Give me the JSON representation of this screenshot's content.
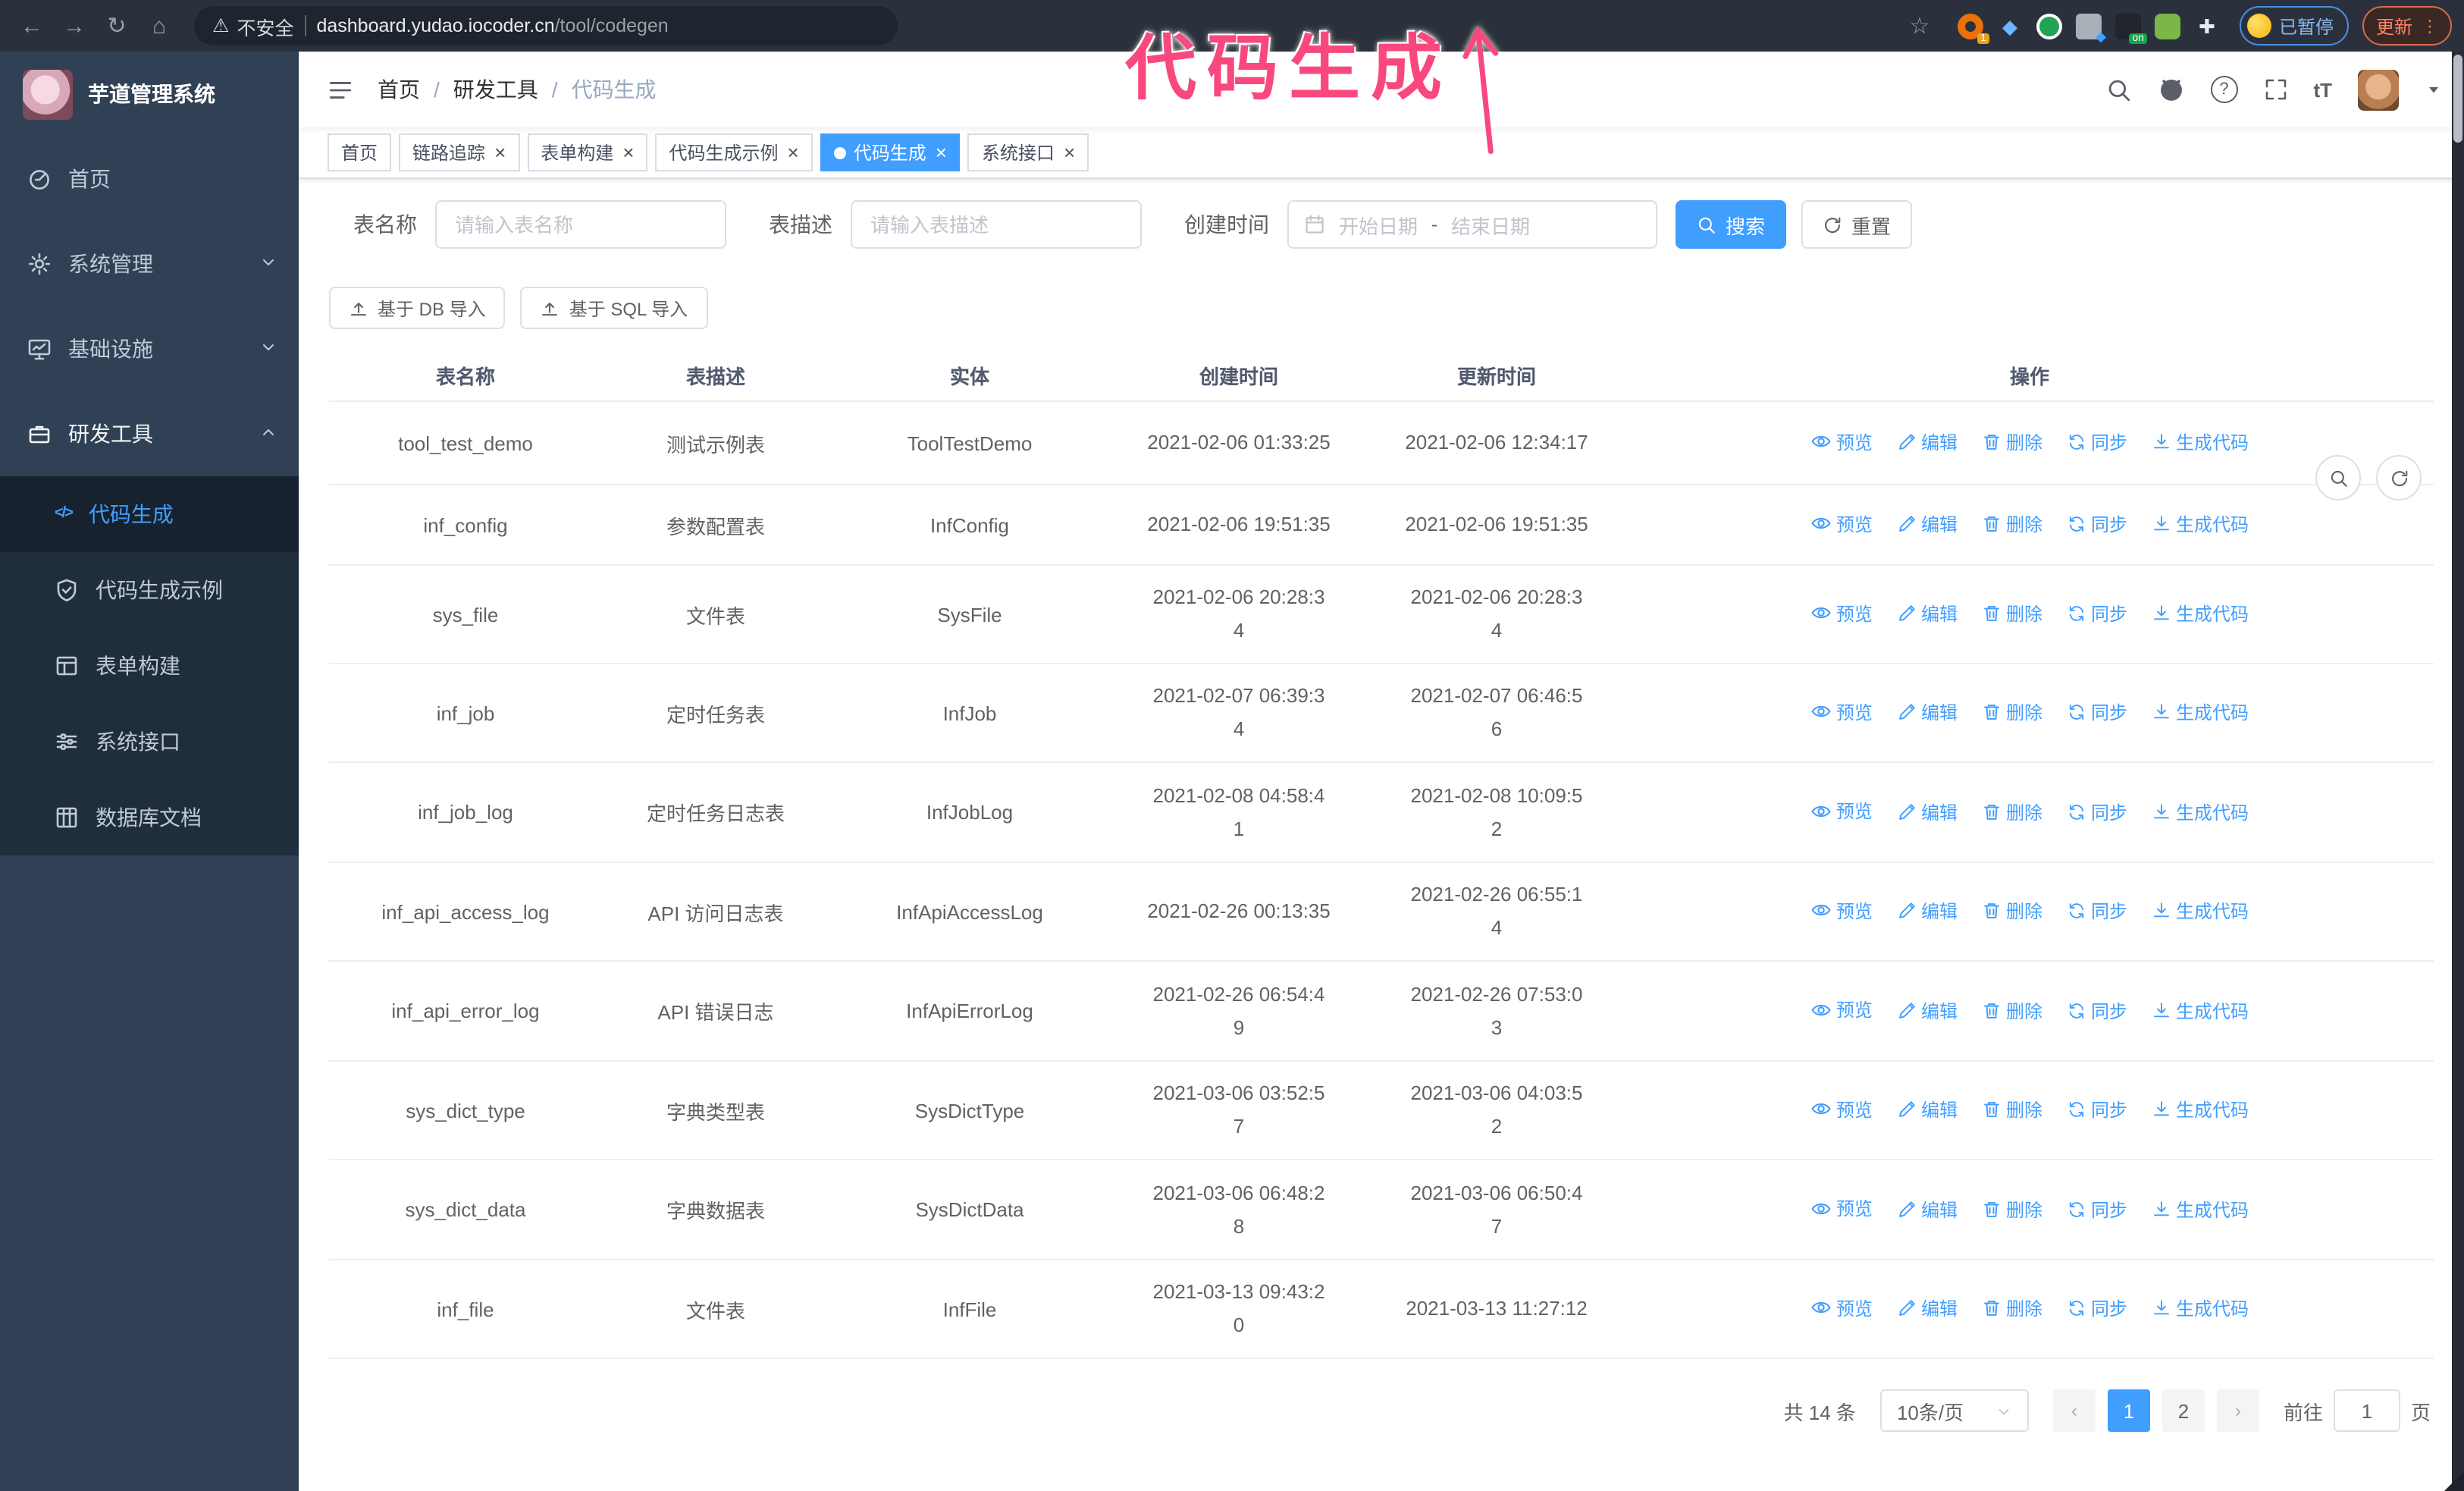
{
  "browser": {
    "security_label": "不安全",
    "url_host": "dashboard.yudao.iocoder.cn",
    "url_path": "/tool/codegen",
    "extension_badge": "1",
    "extension_on_badge": "on",
    "paused_label": "已暂停",
    "update_label": "更新"
  },
  "annotation": {
    "text": "代码生成"
  },
  "sidebar": {
    "title": "芋道管理系统",
    "items": [
      {
        "icon": "dashboard-icon",
        "label": "首页",
        "level": 1
      },
      {
        "icon": "gear-icon",
        "label": "系统管理",
        "level": 1,
        "chevron": "down"
      },
      {
        "icon": "monitor-icon",
        "label": "基础设施",
        "level": 1,
        "chevron": "down"
      },
      {
        "icon": "briefcase-icon",
        "label": "研发工具",
        "level": 1,
        "chevron": "up",
        "open": true
      },
      {
        "icon": "code-icon",
        "label": "代码生成",
        "level": 2,
        "active": true
      },
      {
        "icon": "shield-check-icon",
        "label": "代码生成示例",
        "level": 2
      },
      {
        "icon": "form-icon",
        "label": "表单构建",
        "level": 2
      },
      {
        "icon": "sliders-icon",
        "label": "系统接口",
        "level": 2
      },
      {
        "icon": "database-icon",
        "label": "数据库文档",
        "level": 2
      }
    ]
  },
  "header": {
    "breadcrumb": [
      "首页",
      "研发工具",
      "代码生成"
    ]
  },
  "tabs": [
    {
      "label": "首页",
      "closable": false,
      "active": false
    },
    {
      "label": "链路追踪",
      "closable": true,
      "active": false
    },
    {
      "label": "表单构建",
      "closable": true,
      "active": false
    },
    {
      "label": "代码生成示例",
      "closable": true,
      "active": false
    },
    {
      "label": "代码生成",
      "closable": true,
      "active": true
    },
    {
      "label": "系统接口",
      "closable": true,
      "active": false
    }
  ],
  "filters": {
    "name_label": "表名称",
    "name_placeholder": "请输入表名称",
    "desc_label": "表描述",
    "desc_placeholder": "请输入表描述",
    "time_label": "创建时间",
    "start_placeholder": "开始日期",
    "range_separator": "-",
    "end_placeholder": "结束日期",
    "search_label": "搜索",
    "reset_label": "重置"
  },
  "toolbar": {
    "db_import_label": "基于 DB 导入",
    "sql_import_label": "基于 SQL 导入"
  },
  "table": {
    "columns": [
      "表名称",
      "表描述",
      "实体",
      "创建时间",
      "更新时间",
      "操作"
    ],
    "actions": [
      {
        "name": "preview",
        "icon": "eye-icon",
        "label": "预览"
      },
      {
        "name": "edit",
        "icon": "edit-icon",
        "label": "编辑"
      },
      {
        "name": "delete",
        "icon": "trash-icon",
        "label": "删除"
      },
      {
        "name": "sync",
        "icon": "sync-icon",
        "label": "同步"
      },
      {
        "name": "generate-code",
        "icon": "download-icon",
        "label": "生成代码"
      }
    ],
    "rows": [
      {
        "name": "tool_test_demo",
        "desc": "测试示例表",
        "entity": "ToolTestDemo",
        "created": "2021-02-06 01:33:25",
        "updated": "2021-02-06 12:34:17"
      },
      {
        "name": "inf_config",
        "desc": "参数配置表",
        "entity": "InfConfig",
        "created": "2021-02-06 19:51:35",
        "updated": "2021-02-06 19:51:35"
      },
      {
        "name": "sys_file",
        "desc": "文件表",
        "entity": "SysFile",
        "created": "2021-02-06 20:28:3\n4",
        "updated": "2021-02-06 20:28:3\n4"
      },
      {
        "name": "inf_job",
        "desc": "定时任务表",
        "entity": "InfJob",
        "created": "2021-02-07 06:39:3\n4",
        "updated": "2021-02-07 06:46:5\n6"
      },
      {
        "name": "inf_job_log",
        "desc": "定时任务日志表",
        "entity": "InfJobLog",
        "created": "2021-02-08 04:58:4\n1",
        "updated": "2021-02-08 10:09:5\n2"
      },
      {
        "name": "inf_api_access_log",
        "desc": "API 访问日志表",
        "entity": "InfApiAccessLog",
        "created": "2021-02-26 00:13:35",
        "updated": "2021-02-26 06:55:1\n4"
      },
      {
        "name": "inf_api_error_log",
        "desc": "API 错误日志",
        "entity": "InfApiErrorLog",
        "created": "2021-02-26 06:54:4\n9",
        "updated": "2021-02-26 07:53:0\n3"
      },
      {
        "name": "sys_dict_type",
        "desc": "字典类型表",
        "entity": "SysDictType",
        "created": "2021-03-06 03:52:5\n7",
        "updated": "2021-03-06 04:03:5\n2"
      },
      {
        "name": "sys_dict_data",
        "desc": "字典数据表",
        "entity": "SysDictData",
        "created": "2021-03-06 06:48:2\n8",
        "updated": "2021-03-06 06:50:4\n7"
      },
      {
        "name": "inf_file",
        "desc": "文件表",
        "entity": "InfFile",
        "created": "2021-03-13 09:43:2\n0",
        "updated": "2021-03-13 11:27:12"
      }
    ]
  },
  "pagination": {
    "total_label": "共 14 条",
    "page_size_label": "10条/页",
    "pages": [
      "1",
      "2"
    ],
    "active_page": "1",
    "goto_label": "前往",
    "goto_value": "1",
    "goto_suffix": "页"
  }
}
